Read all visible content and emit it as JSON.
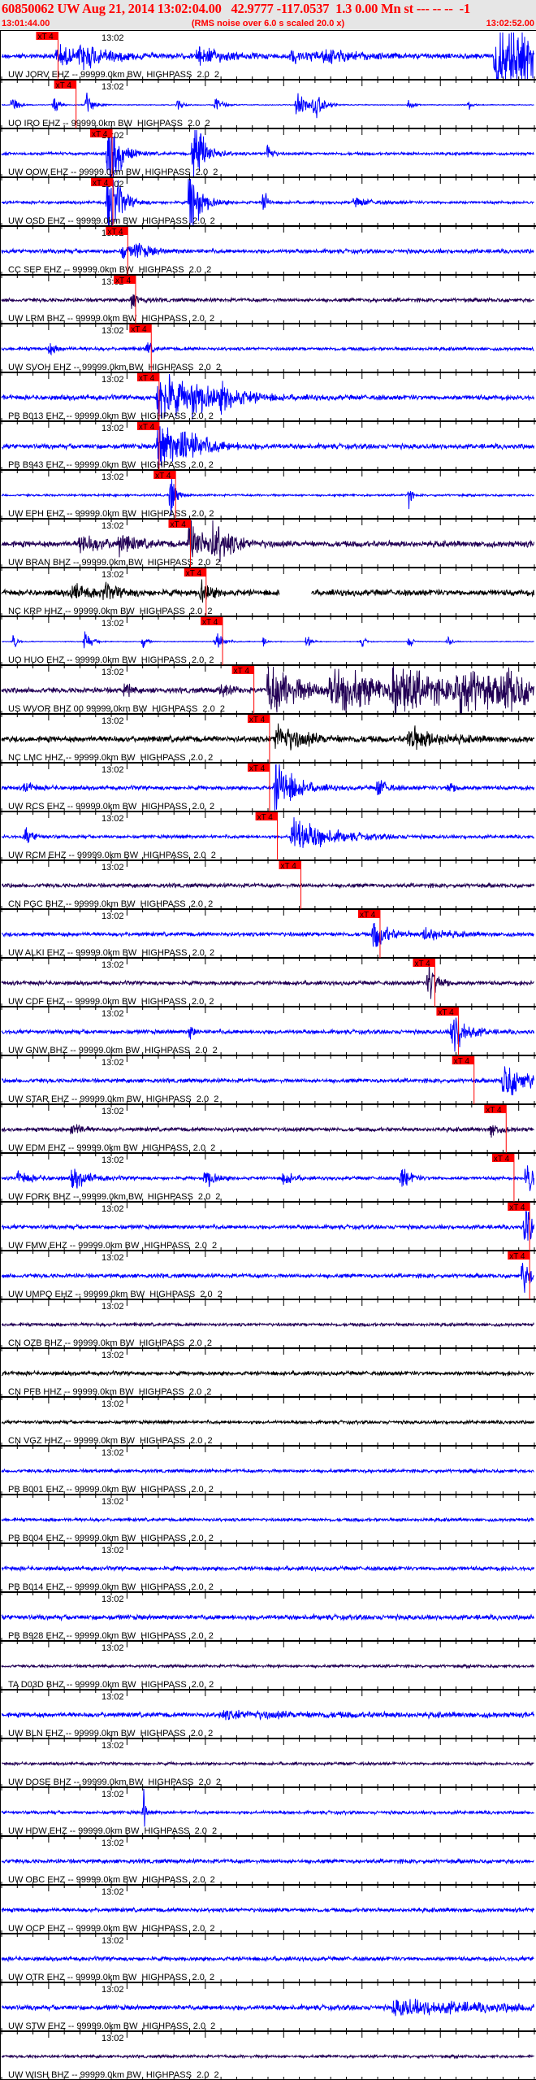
{
  "header": {
    "title": "60850062 UW Aug 21, 2014 13:02:04.00   42.9777 -117.0537  1.3 0.00 Mn st --- -- --  -1",
    "start_time": "13:01:44.00",
    "rms_note": "(RMS noise over 6.0 s scaled 20.0 x)",
    "end_time": "13:02:52.00"
  },
  "axis": {
    "window_seconds": 68,
    "minute_label": "13:02",
    "minute_label_offset_s": 16,
    "minor_tick_s": 2,
    "major_tick_s": 10,
    "pick_label": "xT 4"
  },
  "colors": {
    "blue": "#0000ff",
    "purple": "#220055",
    "black": "#000000",
    "pick": "#ff0000",
    "header_bg": "#e6e6e6",
    "header_text": "#ff0000"
  },
  "traces": [
    {
      "label": "UW JORV EHZ -- 99999.0km BW  HIGHPASS  2.0  2",
      "color": "blue",
      "pick_s": 7.2,
      "base": 0.12,
      "bursts": [
        [
          7,
          0.5,
          3
        ],
        [
          10,
          0.6,
          3
        ],
        [
          25,
          0.45,
          3
        ],
        [
          37,
          0.3,
          3
        ],
        [
          41,
          0.25,
          4
        ],
        [
          63,
          1.6,
          9
        ]
      ]
    },
    {
      "label": "UO IRO EHZ -- 99999.0km BW  HIGHPASS  2.0  2",
      "color": "blue",
      "pick_s": 9.5,
      "base": 0.02,
      "bursts": [
        [
          1.3,
          0.5,
          0.6
        ],
        [
          6.7,
          0.5,
          0.6
        ],
        [
          10.9,
          0.6,
          0.8
        ],
        [
          22.5,
          0.3,
          0.6
        ],
        [
          27.3,
          0.4,
          0.8
        ],
        [
          37.7,
          0.9,
          1.2
        ],
        [
          39.9,
          0.6,
          1
        ],
        [
          52,
          0.3,
          0.5
        ],
        [
          59.6,
          0.3,
          0.5
        ]
      ]
    },
    {
      "label": "UW OOW EHZ -- 99999.0km BW  HIGHPASS  2.0  2",
      "color": "blue",
      "pick_s": 14.1,
      "base": 0.07,
      "bursts": [
        [
          13.6,
          2.5,
          1.2
        ],
        [
          24.5,
          2.2,
          1.2
        ],
        [
          34,
          0.8,
          0.4
        ]
      ]
    },
    {
      "label": "UW OSD EHZ -- 99999.0km BW  HIGHPASS  2.0  2",
      "color": "blue",
      "pick_s": 14.2,
      "base": 0.07,
      "bursts": [
        [
          13.6,
          2.5,
          1.2
        ],
        [
          24,
          2.2,
          1.2
        ],
        [
          33.5,
          0.8,
          0.4
        ],
        [
          45,
          0.2,
          2
        ]
      ]
    },
    {
      "label": "CC SEP EHZ -- 99999.0km BW  HIGHPASS  2.0  2",
      "color": "blue",
      "pick_s": 16.1,
      "base": 0.1,
      "bursts": [
        [
          15.5,
          0.45,
          1
        ],
        [
          17,
          0.35,
          2
        ]
      ]
    },
    {
      "label": "UW LRM BHZ -- 99999.0km BW  HIGHPASS  2.0  2",
      "color": "purple",
      "pick_s": 17.1,
      "base": 0.09,
      "bursts": [
        [
          16.6,
          0.35,
          1
        ]
      ]
    },
    {
      "label": "UW SVOH EHZ -- 99999.0km BW  HIGHPASS  2.0  2",
      "color": "blue",
      "pick_s": 19.1,
      "base": 0.08,
      "bursts": [
        [
          6,
          0.3,
          1
        ],
        [
          18.6,
          0.35,
          0.6
        ]
      ]
    },
    {
      "label": "PB B013 EHZ -- 99999.0km BW  HIGHPASS  2.0  2",
      "color": "blue",
      "pick_s": 20.1,
      "base": 0.12,
      "bursts": [
        [
          20,
          1.6,
          3
        ],
        [
          24,
          0.7,
          3
        ],
        [
          28,
          0.4,
          3
        ]
      ]
    },
    {
      "label": "PB B943 EHZ -- 99999.0km BW  HIGHPASS  2.0  2",
      "color": "blue",
      "pick_s": 20.1,
      "base": 0.12,
      "bursts": [
        [
          20,
          1.6,
          2
        ],
        [
          23,
          0.7,
          3
        ]
      ]
    },
    {
      "label": "UW EPH EHZ -- 99999.0km BW  HIGHPASS  2.0  2",
      "color": "blue",
      "pick_s": 22.2,
      "base": 0.05,
      "bursts": [
        [
          21.6,
          1.3,
          0.5
        ],
        [
          52,
          0.6,
          0.3
        ]
      ]
    },
    {
      "label": "UW BRAN BHZ -- 99999.0km BW  HIGHPASS  2.0  2",
      "color": "purple",
      "pick_s": 24.1,
      "base": 0.15,
      "bursts": [
        [
          10,
          0.4,
          3
        ],
        [
          15,
          0.4,
          2
        ],
        [
          24,
          1.2,
          2
        ],
        [
          27,
          0.9,
          2
        ]
      ]
    },
    {
      "label": "NC KRP HHZ -- 99999.0km BW  HIGHPASS  2.0  2",
      "color": "black",
      "pick_s": 26.1,
      "base": 0.15,
      "bursts": [
        [
          9,
          0.4,
          2
        ],
        [
          13,
          0.3,
          2
        ],
        [
          25.5,
          0.6,
          1
        ]
      ],
      "gaps": [
        [
          35.5,
          39.5
        ]
      ]
    },
    {
      "label": "UO HUO EHZ -- 99999.0km BW  HIGHPASS  2.0  2",
      "color": "blue",
      "pick_s": 28.2,
      "base": 0.02,
      "bursts": [
        [
          1.5,
          0.6,
          0.4
        ],
        [
          10.6,
          0.6,
          0.7
        ],
        [
          18.1,
          0.45,
          0.4
        ],
        [
          27.3,
          0.6,
          0.8
        ],
        [
          33.5,
          0.3,
          0.4
        ],
        [
          39,
          0.5,
          0.4
        ],
        [
          46,
          0.3,
          0.4
        ],
        [
          52,
          0.4,
          0.4
        ],
        [
          57,
          0.3,
          0.4
        ]
      ]
    },
    {
      "label": "US WVOR BHZ 00 99999.0km BW  HIGHPASS  2.0  2",
      "color": "purple",
      "pick_s": 32.2,
      "base": 0.13,
      "bursts": [
        [
          15.8,
          0.45,
          0.5
        ],
        [
          28,
          0.4,
          1
        ],
        [
          34,
          1.3,
          4
        ],
        [
          42,
          1.4,
          5
        ],
        [
          50,
          1.3,
          5
        ],
        [
          58,
          1.2,
          5
        ],
        [
          64,
          0.8,
          3
        ]
      ]
    },
    {
      "label": "NC LMC HHZ -- 99999.0km BW  HIGHPASS  2.0  2",
      "color": "black",
      "pick_s": 34.2,
      "base": 0.15,
      "bursts": [
        [
          35,
          0.8,
          3
        ],
        [
          52,
          0.6,
          3
        ]
      ]
    },
    {
      "label": "UW RCS EHZ -- 99999.0km BW  HIGHPASS  2.0  2",
      "color": "blue",
      "pick_s": 34.2,
      "base": 0.1,
      "bursts": [
        [
          3,
          0.3,
          1
        ],
        [
          35,
          1.6,
          2
        ],
        [
          48,
          0.5,
          1
        ],
        [
          57,
          0.3,
          1
        ]
      ]
    },
    {
      "label": "UW RCM EHZ -- 99999.0km BW  HIGHPASS  2.0  2",
      "color": "blue",
      "pick_s": 35.2,
      "base": 0.08,
      "bursts": [
        [
          3,
          0.4,
          1
        ],
        [
          37,
          1,
          4
        ]
      ]
    },
    {
      "label": "CN PGC BHZ -- 99999.0km BW  HIGHPASS  2.0  2",
      "color": "purple",
      "pick_s": 38.2,
      "base": 0.1,
      "bursts": []
    },
    {
      "label": "UW ALKI EHZ -- 99999.0km BW  HIGHPASS  2.0  2",
      "color": "blue",
      "pick_s": 48.3,
      "base": 0.1,
      "bursts": [
        [
          47.5,
          0.9,
          1.5
        ],
        [
          54,
          0.4,
          2
        ]
      ]
    },
    {
      "label": "UW CDF EHZ -- 99999.0km BW  HIGHPASS  2.0  2",
      "color": "purple",
      "pick_s": 55.3,
      "base": 0.1,
      "bursts": [
        [
          54.5,
          1.2,
          1
        ]
      ]
    },
    {
      "label": "UW GNW BHZ -- 99999.0km BW  HIGHPASS  2.0  2",
      "color": "blue",
      "pick_s": 58.3,
      "base": 0.1,
      "bursts": [
        [
          24,
          0.4,
          0.5
        ],
        [
          57.5,
          1.2,
          1.5
        ]
      ]
    },
    {
      "label": "UW STAR EHZ -- 99999.0km BW  HIGHPASS  2.0  2",
      "color": "blue",
      "pick_s": 60.3,
      "base": 0.1,
      "bursts": [
        [
          64,
          0.9,
          3
        ]
      ]
    },
    {
      "label": "UW EDM EHZ -- 99999.0km BW  HIGHPASS  2.0  2",
      "color": "purple",
      "pick_s": 64.4,
      "base": 0.1,
      "bursts": [
        [
          9,
          0.4,
          1
        ],
        [
          62.5,
          0.35,
          1
        ]
      ]
    },
    {
      "label": "UW FORK BHZ -- 99999.0km BW  HIGHPASS  2.0  2",
      "color": "blue",
      "pick_s": 65.4,
      "base": 0.08,
      "bursts": [
        [
          2,
          0.3,
          2
        ],
        [
          9,
          0.5,
          2
        ],
        [
          26,
          0.6,
          1
        ],
        [
          36,
          0.4,
          1
        ],
        [
          51,
          0.6,
          1
        ],
        [
          67,
          1.1,
          1
        ]
      ]
    },
    {
      "label": "UW FMW EHZ -- 99999.0km BW  HIGHPASS  2.0  2",
      "color": "blue",
      "pick_s": 67.4,
      "base": 0.1,
      "bursts": [
        [
          66.8,
          1.3,
          0.8
        ]
      ]
    },
    {
      "label": "UW UMPQ EHZ -- 99999.0km BW  HIGHPASS  2.0  2",
      "color": "blue",
      "pick_s": 67.4,
      "base": 0.1,
      "bursts": [
        [
          66.5,
          1,
          0.8
        ]
      ]
    },
    {
      "label": "CN OZB BHZ -- 99999.0km BW  HIGHPASS  2.0  2",
      "color": "purple",
      "base": 0.08,
      "bursts": []
    },
    {
      "label": "CN PFB HHZ -- 99999.0km BW  HIGHPASS  2.0  2",
      "color": "black",
      "base": 0.1,
      "bursts": []
    },
    {
      "label": "CN VGZ HHZ -- 99999.0km BW  HIGHPASS  2.0  2",
      "color": "black",
      "base": 0.08,
      "bursts": []
    },
    {
      "label": "PB B001 EHZ -- 99999.0km BW  HIGHPASS  2.0  2",
      "color": "blue",
      "base": 0.08,
      "bursts": []
    },
    {
      "label": "PB B004 EHZ -- 99999.0km BW  HIGHPASS  2.0  2",
      "color": "blue",
      "base": 0.08,
      "bursts": []
    },
    {
      "label": "PB B014 EHZ -- 99999.0km BW  HIGHPASS  2.0  2",
      "color": "blue",
      "base": 0.1,
      "bursts": []
    },
    {
      "label": "PB B928 EHZ -- 99999.0km BW  HIGHPASS  2.0  2",
      "color": "blue",
      "base": 0.12,
      "bursts": []
    },
    {
      "label": "TA D03D BHZ -- 99999.0km BW  HIGHPASS  2.0  2",
      "color": "purple",
      "base": 0.07,
      "bursts": []
    },
    {
      "label": "UW BLN EHZ -- 99999.0km BW  HIGHPASS  2.0  2",
      "color": "blue",
      "base": 0.12,
      "bursts": [
        [
          28,
          0.15,
          12
        ]
      ]
    },
    {
      "label": "UW DOSE BHZ -- 99999.0km BW  HIGHPASS  2.0  2",
      "color": "purple",
      "base": 0.07,
      "bursts": []
    },
    {
      "label": "UW HDW EHZ -- 99999.0km BW  HIGHPASS  2.0  2",
      "color": "blue",
      "base": 0.08,
      "bursts": [
        [
          18.2,
          1.6,
          0.15
        ]
      ]
    },
    {
      "label": "UW OBC EHZ -- 99999.0km BW  HIGHPASS  2.0  2",
      "color": "blue",
      "base": 0.1,
      "bursts": []
    },
    {
      "label": "UW OCP EHZ -- 99999.0km BW  HIGHPASS  2.0  2",
      "color": "blue",
      "base": 0.1,
      "bursts": []
    },
    {
      "label": "UW OTR EHZ -- 99999.0km BW  HIGHPASS  2.0  2",
      "color": "blue",
      "base": 0.1,
      "bursts": []
    },
    {
      "label": "UW STW EHZ -- 99999.0km BW  HIGHPASS  2.0  2",
      "color": "blue",
      "base": 0.12,
      "bursts": [
        [
          50,
          0.35,
          12
        ]
      ]
    },
    {
      "label": "UW WISH BHZ -- 99999.0km BW  HIGHPASS  2.0  2",
      "color": "purple",
      "base": 0.07,
      "bursts": []
    }
  ]
}
